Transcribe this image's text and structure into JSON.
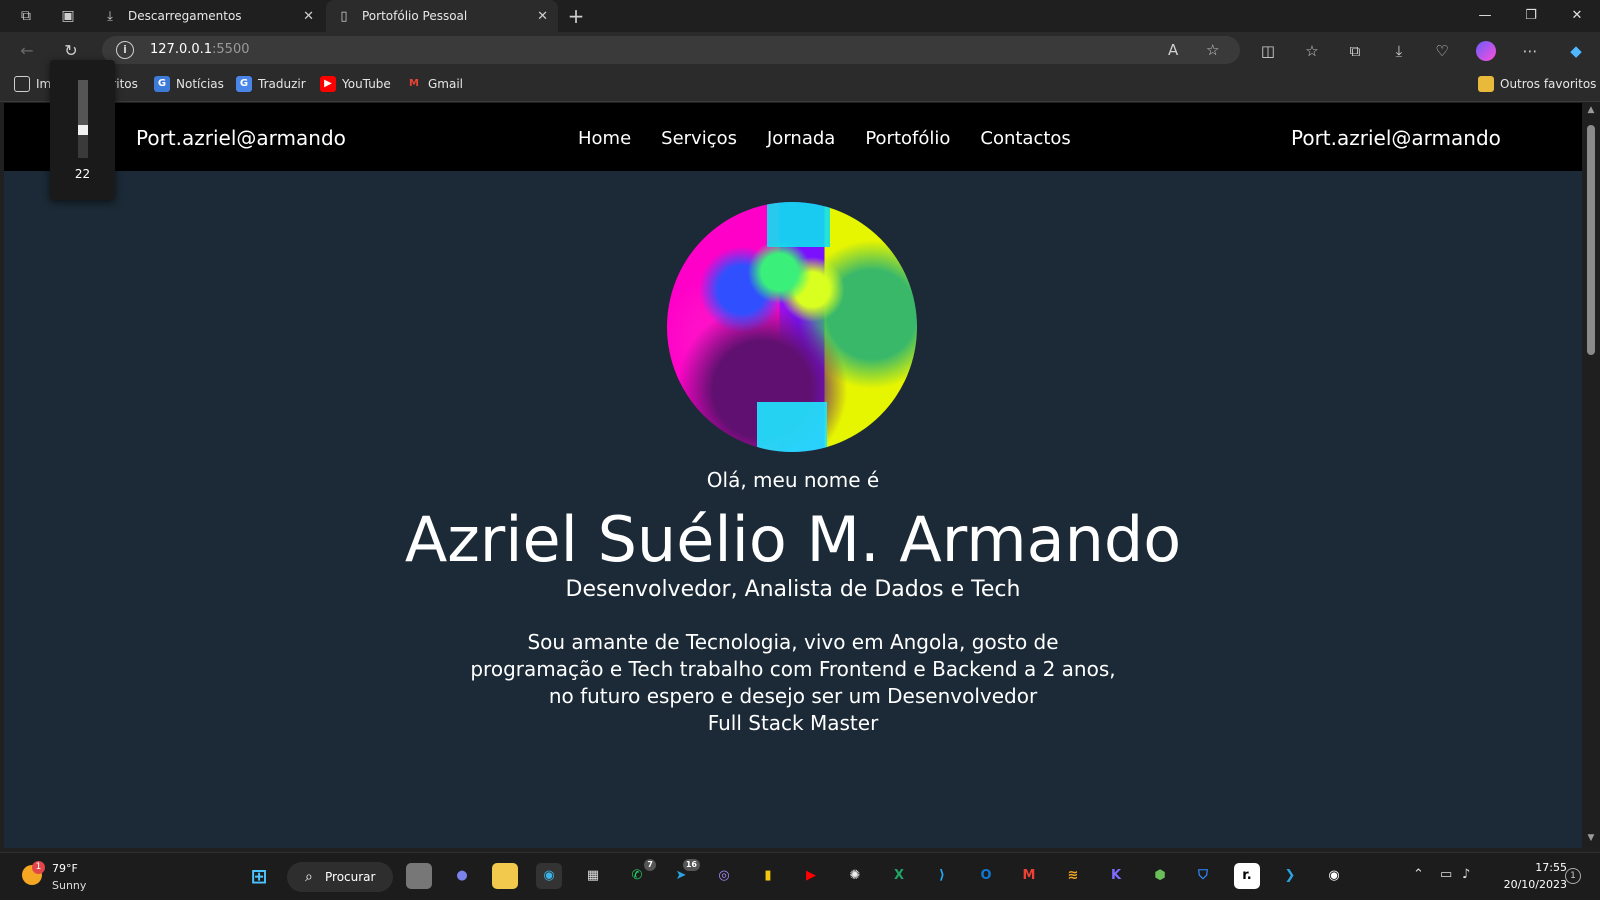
{
  "browser": {
    "tabs": [
      {
        "label": "Descarregamentos",
        "icon": "download-icon"
      },
      {
        "label": "Portofólio Pessoal",
        "icon": "page-icon"
      }
    ],
    "url_host": "127.0.0.1",
    "url_port": ":5500",
    "bookmarks": [
      {
        "label": "Impor... favoritos",
        "icon": "import-icon"
      },
      {
        "label": "Notícias",
        "icon": "news-icon"
      },
      {
        "label": "Traduzir",
        "icon": "translate-icon"
      },
      {
        "label": "YouTube",
        "icon": "youtube-icon"
      },
      {
        "label": "Gmail",
        "icon": "gmail-icon"
      }
    ],
    "other_favorites": "Outros favoritos"
  },
  "volume": {
    "value": "22",
    "level_percent": 22
  },
  "site": {
    "logo_left": "Port.azriel@armando",
    "logo_right": "Port.azriel@armando",
    "menu": [
      "Home",
      "Serviços",
      "Jornada",
      "Portofólio",
      "Contactos"
    ],
    "greeting": "Olá, meu nome é",
    "name": "Azriel Suélio M. Armando",
    "role": "Desenvolvedor, Analista de Dados e Tech",
    "bio_lines": [
      "Sou amante de Tecnologia, vivo em Angola, gosto de",
      "programação e Tech trabalho com Frontend e Backend a 2 anos,",
      "no futuro espero e desejo ser um Desenvolvedor",
      "Full Stack Master"
    ]
  },
  "taskbar": {
    "weather_temp": "79°F",
    "weather_condition": "Sunny",
    "weather_badge": "1",
    "search_label": "Procurar",
    "whatsapp_badge": "7",
    "telegram_badge": "16",
    "time": "17:55",
    "date": "20/10/2023",
    "notification_count": "1"
  },
  "colors": {
    "page_bg": "#1b2a36",
    "header_bg": "#000000",
    "text": "#ffffff"
  }
}
